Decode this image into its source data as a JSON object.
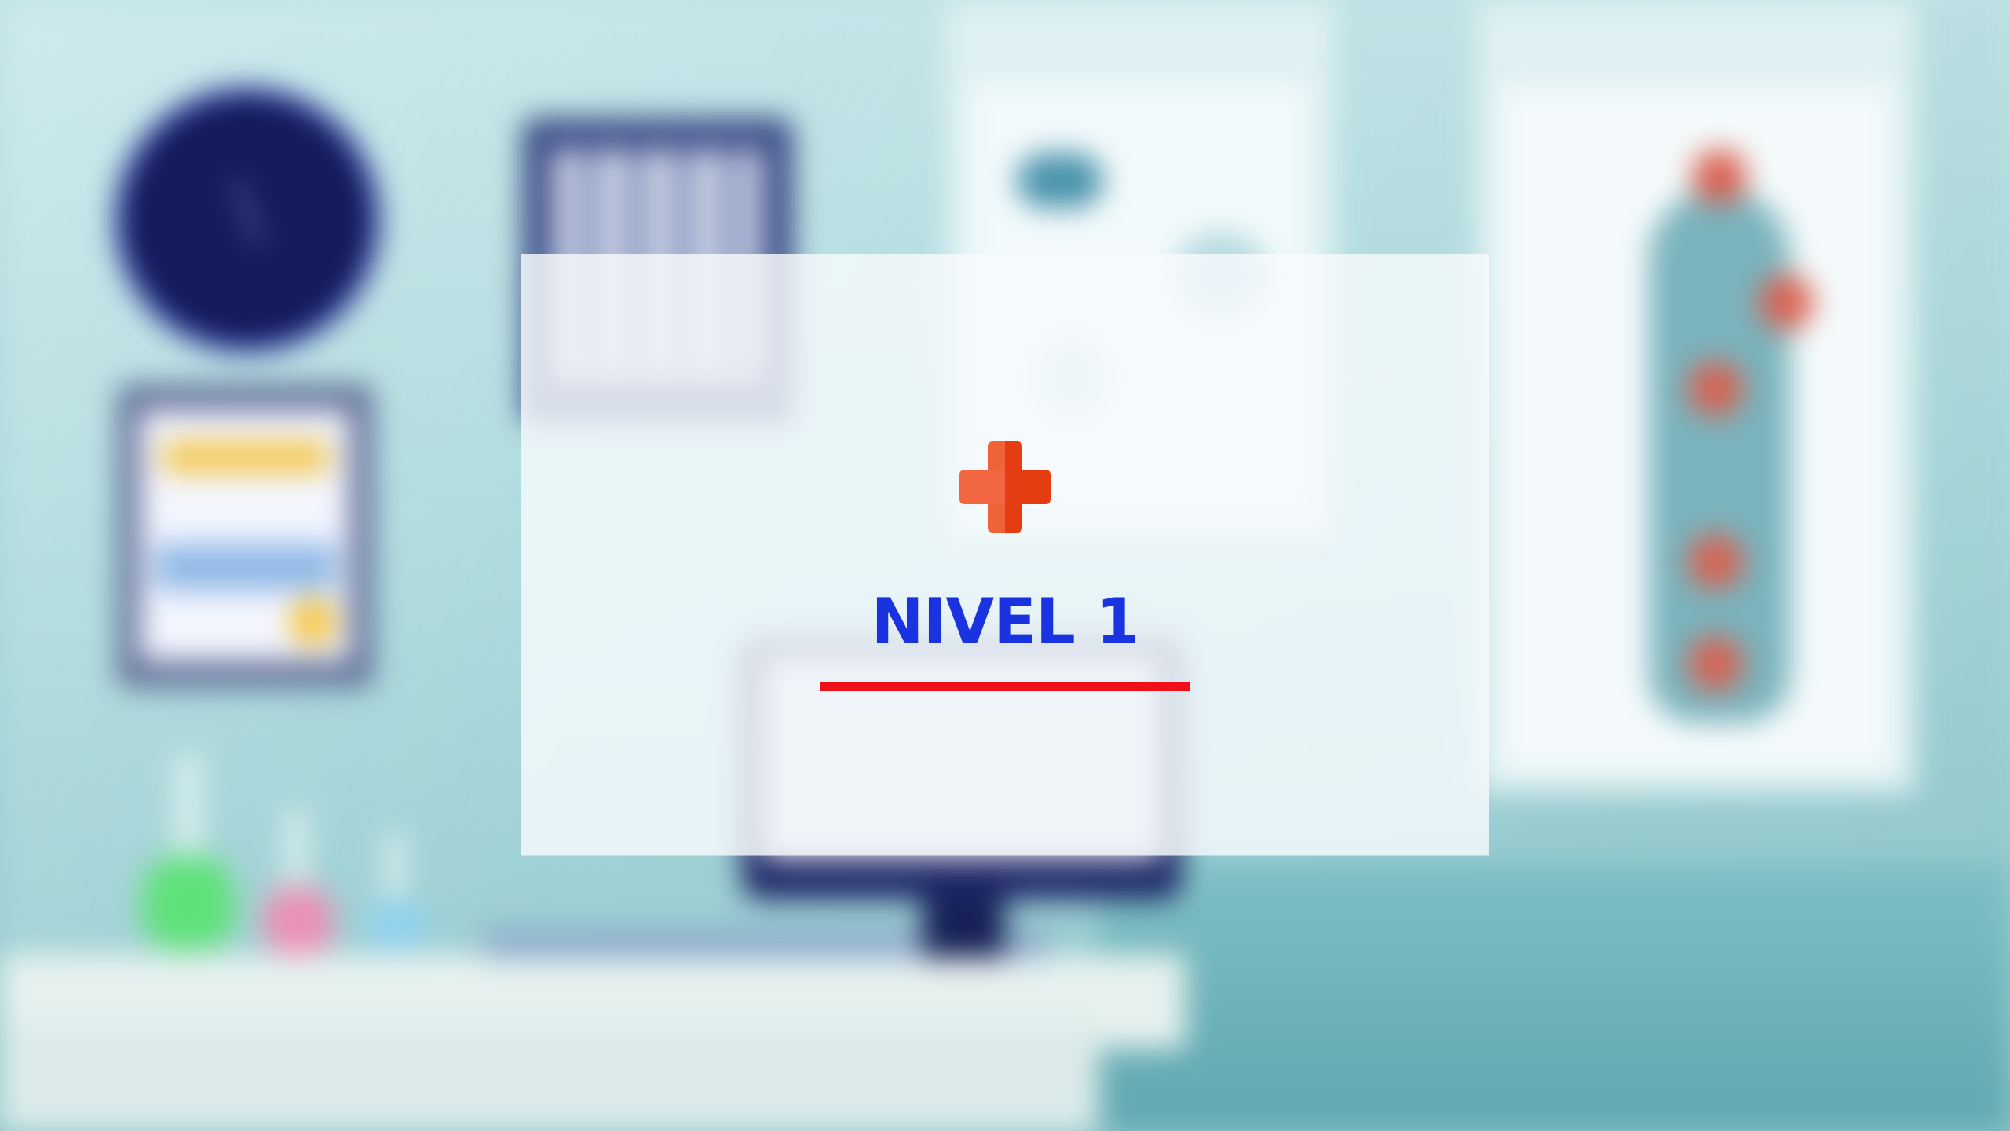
{
  "screen": {
    "title": "NIVEL 1",
    "icon": "medical-cross-icon"
  },
  "colors": {
    "title": "#1a33e0",
    "underline": "#f0101a",
    "cross_light": "#f0633a",
    "cross_dark": "#e43d12"
  }
}
